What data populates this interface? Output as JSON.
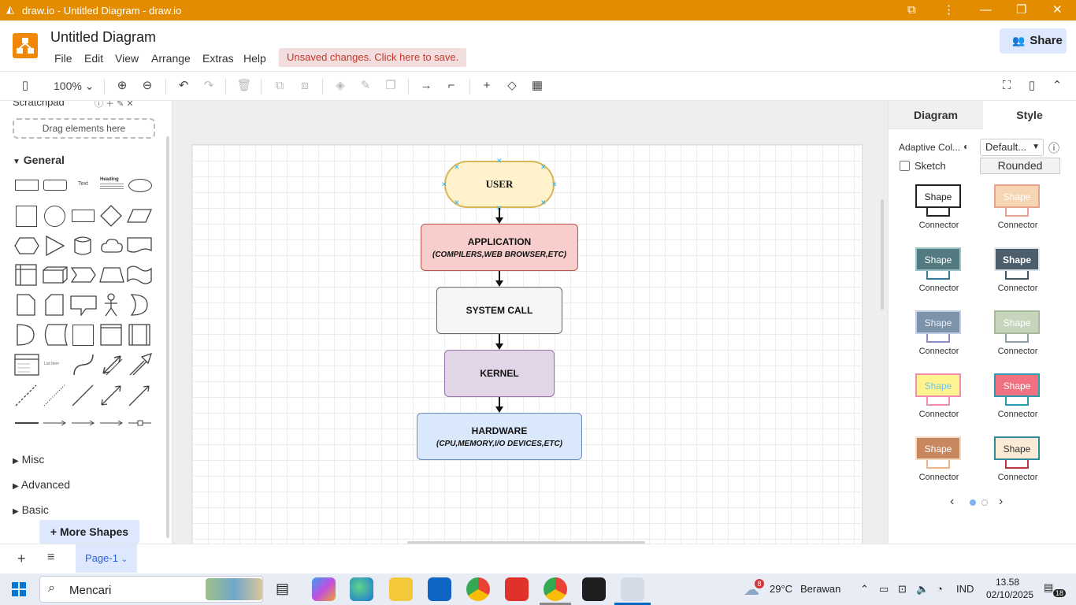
{
  "window": {
    "title": "draw.io - Untitled Diagram - draw.io"
  },
  "header": {
    "doc_title": "Untitled Diagram",
    "menu": [
      "File",
      "Edit",
      "View",
      "Arrange",
      "Extras",
      "Help"
    ],
    "unsaved_notice": "Unsaved changes. Click here to save.",
    "share_label": "Share"
  },
  "toolbar": {
    "zoom": "100%"
  },
  "sidebar": {
    "scratchpad_label": "Scratchpad",
    "drag_hint": "Drag elements here",
    "sections": {
      "general": "General",
      "misc": "Misc",
      "advanced": "Advanced",
      "basic": "Basic"
    },
    "tiny_labels": {
      "text": "Text",
      "heading": "Heading",
      "list_item": "List Item"
    },
    "more_shapes": "+ More Shapes"
  },
  "diagram": {
    "nodes": [
      {
        "label": "USER",
        "sub": ""
      },
      {
        "label": "APPLICATION",
        "sub": "(COMPILERS,WEB BROWSER,ETC)"
      },
      {
        "label": "SYSTEM CALL",
        "sub": ""
      },
      {
        "label": "KERNEL",
        "sub": ""
      },
      {
        "label": "HARDWARE",
        "sub": "(CPU,MEMORY,I/O DEVICES,ETC)"
      }
    ],
    "colors": {
      "user_fill": "#fff2cc",
      "user_stroke": "#d6b656",
      "app_fill": "#f8cecc",
      "app_stroke": "#b85450",
      "syscall_fill": "#f5f5f5",
      "syscall_stroke": "#666666",
      "kernel_fill": "#e1d5e7",
      "kernel_stroke": "#9673a6",
      "hw_fill": "#dae8fc",
      "hw_stroke": "#6c8ebf"
    }
  },
  "right_panel": {
    "tabs": [
      "Diagram",
      "Style"
    ],
    "adaptive_label": "Adaptive Col...",
    "default_select": "Default...",
    "sketch_label": "Sketch",
    "rounded_label": "Rounded",
    "shape_label": "Shape",
    "connector_label": "Connector"
  },
  "bottom": {
    "page_tab": "Page-1"
  },
  "taskbar": {
    "search_placeholder": "Mencari",
    "weather_temp": "29°C",
    "weather_desc": "Berawan",
    "weather_badge": "8",
    "language": "IND",
    "time": "13.58",
    "date": "02/10/2025",
    "notif_count": "18"
  }
}
